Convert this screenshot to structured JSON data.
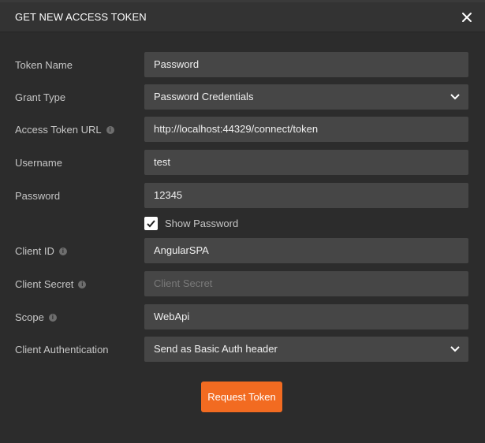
{
  "dialog": {
    "title": "GET NEW ACCESS TOKEN",
    "close_icon": "close-icon"
  },
  "fields": {
    "token_name": {
      "label": "Token Name",
      "value": "Password"
    },
    "grant_type": {
      "label": "Grant Type",
      "value": "Password Credentials"
    },
    "access_token_url": {
      "label": "Access Token URL",
      "value": "http://localhost:44329/connect/token"
    },
    "username": {
      "label": "Username",
      "value": "test"
    },
    "password": {
      "label": "Password",
      "value": "12345"
    },
    "client_id": {
      "label": "Client ID",
      "value": "AngularSPA"
    },
    "client_secret": {
      "label": "Client Secret",
      "value": "",
      "placeholder": "Client Secret"
    },
    "scope": {
      "label": "Scope",
      "value": "WebApi"
    },
    "client_auth": {
      "label": "Client Authentication",
      "value": "Send as Basic Auth header"
    }
  },
  "show_password": {
    "label": "Show Password",
    "checked": true
  },
  "request_button": {
    "label": "Request Token",
    "color": "#f26b21"
  },
  "info_icon_glyph": "i"
}
